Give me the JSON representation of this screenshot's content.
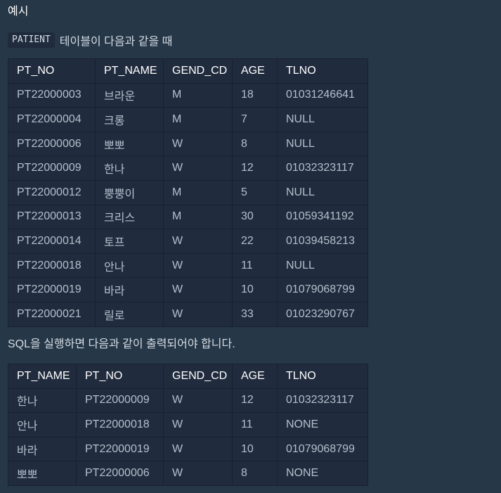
{
  "section_title": "예시",
  "intro": {
    "table_name": "PATIENT",
    "text": "테이블이 다음과 같을 때"
  },
  "patient_table": {
    "headers": [
      "PT_NO",
      "PT_NAME",
      "GEND_CD",
      "AGE",
      "TLNO"
    ],
    "rows": [
      [
        "PT22000003",
        "브라운",
        "M",
        "18",
        "01031246641"
      ],
      [
        "PT22000004",
        "크롱",
        "M",
        "7",
        "NULL"
      ],
      [
        "PT22000006",
        "뽀뽀",
        "W",
        "8",
        "NULL"
      ],
      [
        "PT22000009",
        "한나",
        "W",
        "12",
        "01032323117"
      ],
      [
        "PT22000012",
        "뿡뿡이",
        "M",
        "5",
        "NULL"
      ],
      [
        "PT22000013",
        "크리스",
        "M",
        "30",
        "01059341192"
      ],
      [
        "PT22000014",
        "토프",
        "W",
        "22",
        "01039458213"
      ],
      [
        "PT22000018",
        "안나",
        "W",
        "11",
        "NULL"
      ],
      [
        "PT22000019",
        "바라",
        "W",
        "10",
        "01079068799"
      ],
      [
        "PT22000021",
        "릴로",
        "W",
        "33",
        "01023290767"
      ]
    ]
  },
  "description": "SQL을 실행하면 다음과 같이 출력되어야 합니다.",
  "result_table": {
    "headers": [
      "PT_NAME",
      "PT_NO",
      "GEND_CD",
      "AGE",
      "TLNO"
    ],
    "rows": [
      [
        "한나",
        "PT22000009",
        "W",
        "12",
        "01032323117"
      ],
      [
        "안나",
        "PT22000018",
        "W",
        "11",
        "NONE"
      ],
      [
        "바라",
        "PT22000019",
        "W",
        "10",
        "01079068799"
      ],
      [
        "뽀뽀",
        "PT22000006",
        "W",
        "8",
        "NONE"
      ]
    ]
  },
  "colors": {
    "background": "#263747",
    "table_background": "#202b3d",
    "header_text": "#ffffff",
    "cell_text": "#b2c0cc"
  }
}
